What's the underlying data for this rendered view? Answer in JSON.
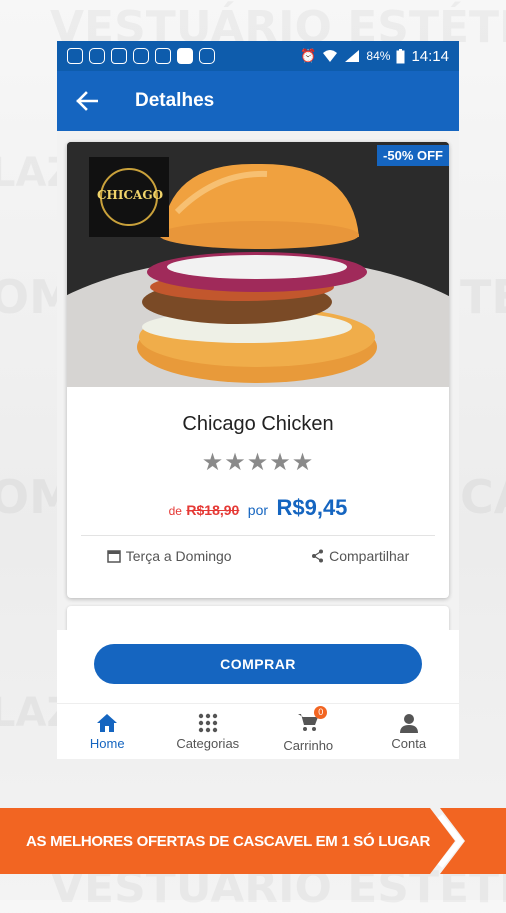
{
  "statusbar": {
    "battery": "84%",
    "time": "14:14"
  },
  "appbar": {
    "title": "Detalhes"
  },
  "product": {
    "badge": "-50% OFF",
    "name": "Chicago Chicken",
    "stars": "★★★★★",
    "de_label": "de",
    "old_price": "R$18,90",
    "por_label": "por",
    "new_price": "R$9,45",
    "availability": "Terça a Domingo",
    "share": "Compartilhar",
    "logo_text": "CHICAGO"
  },
  "cta": {
    "buy_label": "COMPRAR"
  },
  "bottom_nav": {
    "items": [
      {
        "label": "Home",
        "icon": "home-icon"
      },
      {
        "label": "Categorias",
        "icon": "grid-icon"
      },
      {
        "label": "Carrinho",
        "icon": "cart-icon",
        "badge": "0"
      },
      {
        "label": "Conta",
        "icon": "person-icon"
      }
    ]
  },
  "banner": {
    "text": "AS MELHORES OFERTAS DE CASCAVEL EM 1 SÓ LUGAR"
  },
  "colors": {
    "primary": "#1565c0",
    "statusbar": "#0e5cac",
    "accent": "#f26522",
    "price_old": "#e53935"
  }
}
